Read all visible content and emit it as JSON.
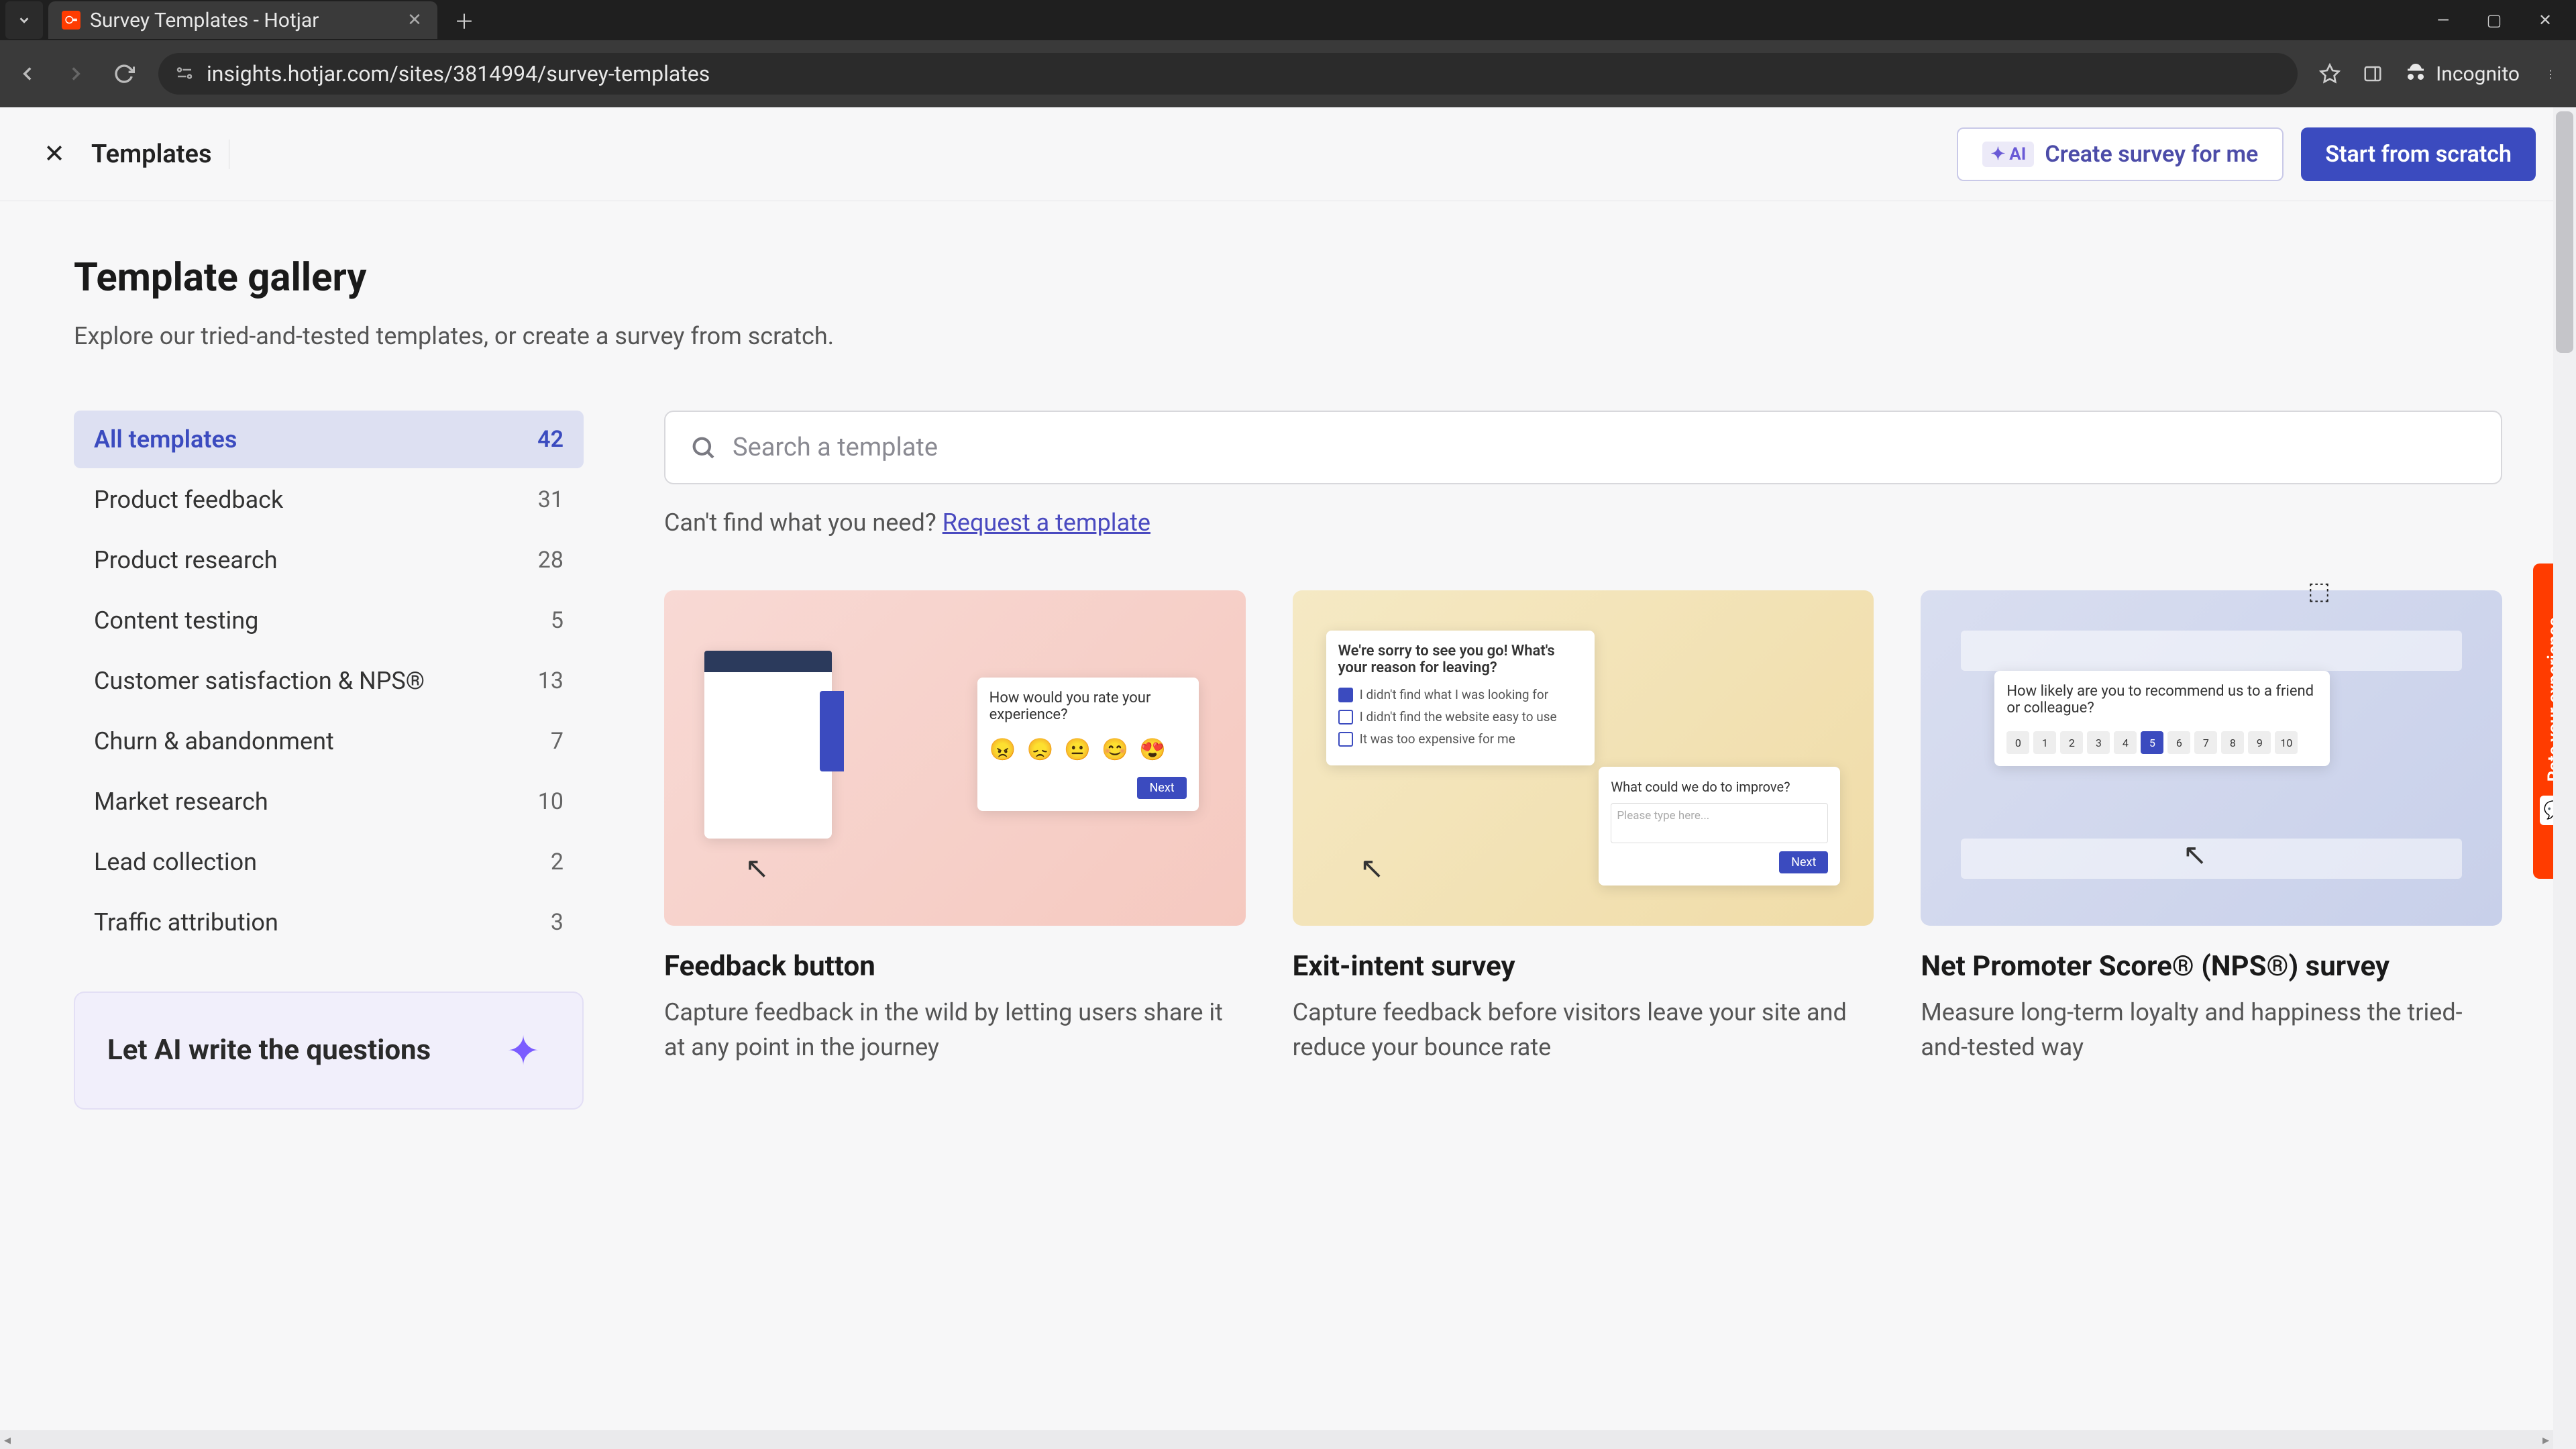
{
  "browser": {
    "tab_title": "Survey Templates - Hotjar",
    "url_display": "insights.hotjar.com/sites/3814994/survey-templates",
    "incognito_label": "Incognito"
  },
  "header": {
    "title": "Templates",
    "ai_chip": "AI",
    "create_label": "Create survey for me",
    "scratch_label": "Start from scratch"
  },
  "page": {
    "h1": "Template gallery",
    "sub": "Explore our tried-and-tested templates, or create a survey from scratch."
  },
  "search": {
    "placeholder": "Search a template",
    "request_prefix": "Can't find what you need? ",
    "request_link": "Request a template"
  },
  "categories": [
    {
      "label": "All templates",
      "count": "42",
      "active": true
    },
    {
      "label": "Product feedback",
      "count": "31"
    },
    {
      "label": "Product research",
      "count": "28"
    },
    {
      "label": "Content testing",
      "count": "5"
    },
    {
      "label": "Customer satisfaction & NPS®",
      "count": "13"
    },
    {
      "label": "Churn & abandonment",
      "count": "7"
    },
    {
      "label": "Market research",
      "count": "10"
    },
    {
      "label": "Lead collection",
      "count": "2"
    },
    {
      "label": "Traffic attribution",
      "count": "3"
    }
  ],
  "ai_promo": "Let AI write the questions",
  "cards": [
    {
      "title": "Feedback button",
      "desc": "Capture feedback in the wild by letting users share it at any point in the journey",
      "mock_q": "How would you rate your experience?",
      "mock_next": "Next"
    },
    {
      "title": "Exit-intent survey",
      "desc": "Capture feedback before visitors leave your site and reduce your bounce rate",
      "mock_q": "We're sorry to see you go! What's your reason for leaving?",
      "mock_opts": [
        "I didn't find what I was looking for",
        "I didn't find the website easy to use",
        "It was too expensive for me"
      ],
      "mock_improve_q": "What could we do to improve?",
      "mock_improve_ph": "Please type here...",
      "mock_next": "Next"
    },
    {
      "title": "Net Promoter Score® (NPS®) survey",
      "desc": "Measure long-term loyalty and happiness the tried-and-tested way",
      "mock_q": "How likely are you to recommend us to a friend or colleague?",
      "mock_scale": [
        "0",
        "1",
        "2",
        "3",
        "4",
        "5",
        "6",
        "7",
        "8",
        "9",
        "10"
      ],
      "mock_selected": "5"
    }
  ],
  "feedback_tab": "Rate your experience"
}
